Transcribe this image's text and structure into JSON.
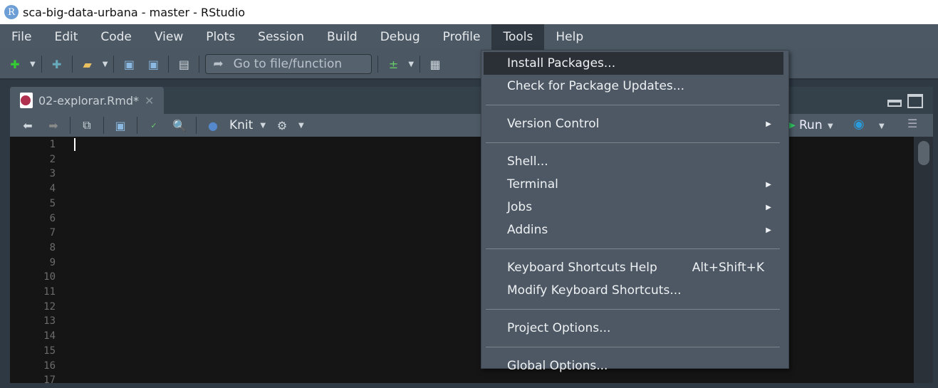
{
  "window": {
    "title": "sca-big-data-urbana - master - RStudio",
    "logo": "R"
  },
  "menubar": [
    "File",
    "Edit",
    "Code",
    "View",
    "Plots",
    "Session",
    "Build",
    "Debug",
    "Profile",
    "Tools",
    "Help"
  ],
  "toolbar": {
    "goto_placeholder": "Go to file/function"
  },
  "editor": {
    "tab_label": "02-explorar.Rmd*",
    "knit_label": "Knit",
    "run_label": "Run",
    "line_numbers": [
      "1",
      "2",
      "3",
      "4",
      "5",
      "6",
      "7",
      "8",
      "9",
      "10",
      "11",
      "12",
      "13",
      "14",
      "15",
      "16",
      "17"
    ]
  },
  "tools_menu": {
    "install": "Install Packages...",
    "check_updates": "Check for Package Updates...",
    "version_control": "Version Control",
    "shell": "Shell...",
    "terminal": "Terminal",
    "jobs": "Jobs",
    "addins": "Addins",
    "shortcuts_help": "Keyboard Shortcuts Help",
    "shortcuts_help_key": "Alt+Shift+K",
    "modify_shortcuts": "Modify Keyboard Shortcuts...",
    "project_options": "Project Options...",
    "global_options": "Global Options..."
  }
}
